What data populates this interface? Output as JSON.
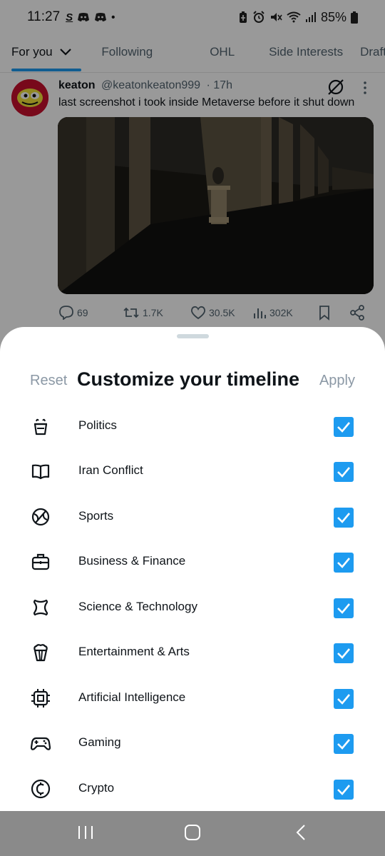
{
  "statusbar": {
    "time": "11:27",
    "app_icons": [
      "S",
      "discord",
      "discord",
      "•"
    ],
    "battery": "85%",
    "icons": [
      "battery-saver-icon",
      "alarm-icon",
      "mute-icon",
      "wifi-icon",
      "signal-icon",
      "battery-icon"
    ]
  },
  "tabs": [
    {
      "label": "For you",
      "active": true
    },
    {
      "label": "Following",
      "active": false
    },
    {
      "label": "OHL",
      "active": false
    },
    {
      "label": "Side Interests",
      "active": false
    },
    {
      "label": "Draft",
      "active": false
    }
  ],
  "tweet": {
    "name": "keaton",
    "handle": "@keatonkeaton999",
    "time": "· 17h",
    "text": "last screenshot i took inside Metaverse before it shut down",
    "replies": "69",
    "reposts": "1.7K",
    "likes": "30.5K",
    "views": "302K"
  },
  "sheet": {
    "reset_label": "Reset",
    "title": "Customize your timeline",
    "apply_label": "Apply",
    "topics": [
      {
        "label": "Politics",
        "icon": "podium-icon",
        "checked": true
      },
      {
        "label": "Iran Conflict",
        "icon": "book-icon",
        "checked": true
      },
      {
        "label": "Sports",
        "icon": "ball-icon",
        "checked": true
      },
      {
        "label": "Business & Finance",
        "icon": "briefcase-icon",
        "checked": true
      },
      {
        "label": "Science & Technology",
        "icon": "atom-icon",
        "checked": true
      },
      {
        "label": "Entertainment & Arts",
        "icon": "popcorn-icon",
        "checked": true
      },
      {
        "label": "Artificial Intelligence",
        "icon": "chip-icon",
        "checked": true
      },
      {
        "label": "Gaming",
        "icon": "gamepad-icon",
        "checked": true
      },
      {
        "label": "Crypto",
        "icon": "coin-icon",
        "checked": true
      }
    ]
  },
  "colors": {
    "accent": "#1d9bf0",
    "text": "#0f1419",
    "muted": "#536471",
    "navbar": "#8a8a8a"
  }
}
